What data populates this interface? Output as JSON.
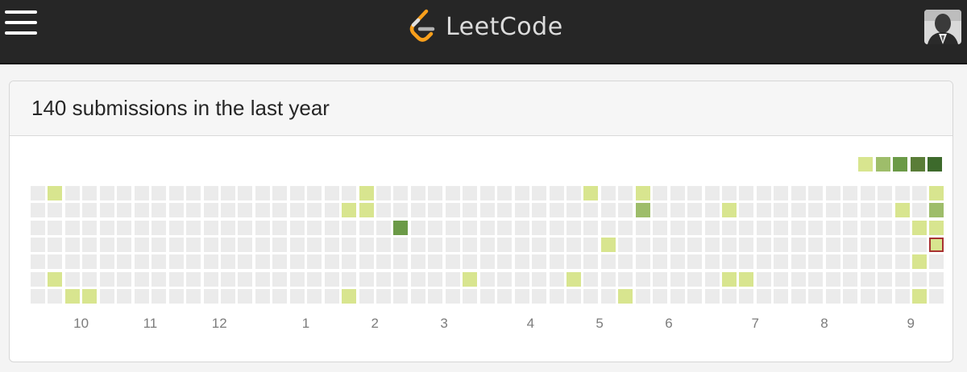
{
  "header": {
    "menu_icon": "hamburger-menu-icon",
    "logo_icon": "leetcode-logo-icon",
    "brand": "LeetCode",
    "avatar_icon": "user-avatar-icon"
  },
  "panel": {
    "title": "140 submissions in the last year"
  },
  "calendar": {
    "levels": [
      "#ebebeb",
      "#d8e58f",
      "#9ebd6a",
      "#6b9a47",
      "#5a7d38",
      "#3d6a2c"
    ],
    "legend_levels": [
      1,
      2,
      3,
      4,
      5
    ],
    "weeks": 53,
    "days": 7,
    "active_cells": [
      {
        "week": 1,
        "day": 0,
        "level": 1
      },
      {
        "week": 1,
        "day": 5,
        "level": 1
      },
      {
        "week": 2,
        "day": 6,
        "level": 1
      },
      {
        "week": 3,
        "day": 6,
        "level": 1
      },
      {
        "week": 18,
        "day": 1,
        "level": 1
      },
      {
        "week": 18,
        "day": 6,
        "level": 1
      },
      {
        "week": 19,
        "day": 0,
        "level": 1
      },
      {
        "week": 19,
        "day": 1,
        "level": 1
      },
      {
        "week": 21,
        "day": 2,
        "level": 3
      },
      {
        "week": 25,
        "day": 5,
        "level": 1
      },
      {
        "week": 31,
        "day": 5,
        "level": 1
      },
      {
        "week": 32,
        "day": 0,
        "level": 1
      },
      {
        "week": 33,
        "day": 3,
        "level": 1
      },
      {
        "week": 34,
        "day": 6,
        "level": 1
      },
      {
        "week": 35,
        "day": 0,
        "level": 1
      },
      {
        "week": 35,
        "day": 1,
        "level": 2
      },
      {
        "week": 40,
        "day": 1,
        "level": 1
      },
      {
        "week": 40,
        "day": 5,
        "level": 1
      },
      {
        "week": 41,
        "day": 5,
        "level": 1
      },
      {
        "week": 50,
        "day": 1,
        "level": 1
      },
      {
        "week": 51,
        "day": 2,
        "level": 1
      },
      {
        "week": 51,
        "day": 4,
        "level": 1
      },
      {
        "week": 51,
        "day": 6,
        "level": 1
      },
      {
        "week": 52,
        "day": 0,
        "level": 1
      },
      {
        "week": 52,
        "day": 1,
        "level": 2
      },
      {
        "week": 52,
        "day": 2,
        "level": 1
      }
    ],
    "today": {
      "week": 52,
      "day": 3,
      "level": 1
    },
    "months": [
      {
        "label": "10",
        "week": 2.5
      },
      {
        "label": "11",
        "week": 6.5
      },
      {
        "label": "12",
        "week": 10.5
      },
      {
        "label": "1",
        "week": 15.5
      },
      {
        "label": "2",
        "week": 19.5
      },
      {
        "label": "3",
        "week": 23.5
      },
      {
        "label": "4",
        "week": 28.5
      },
      {
        "label": "5",
        "week": 32.5
      },
      {
        "label": "6",
        "week": 36.5
      },
      {
        "label": "7",
        "week": 41.5
      },
      {
        "label": "8",
        "week": 45.5
      },
      {
        "label": "9",
        "week": 50.5
      }
    ]
  }
}
